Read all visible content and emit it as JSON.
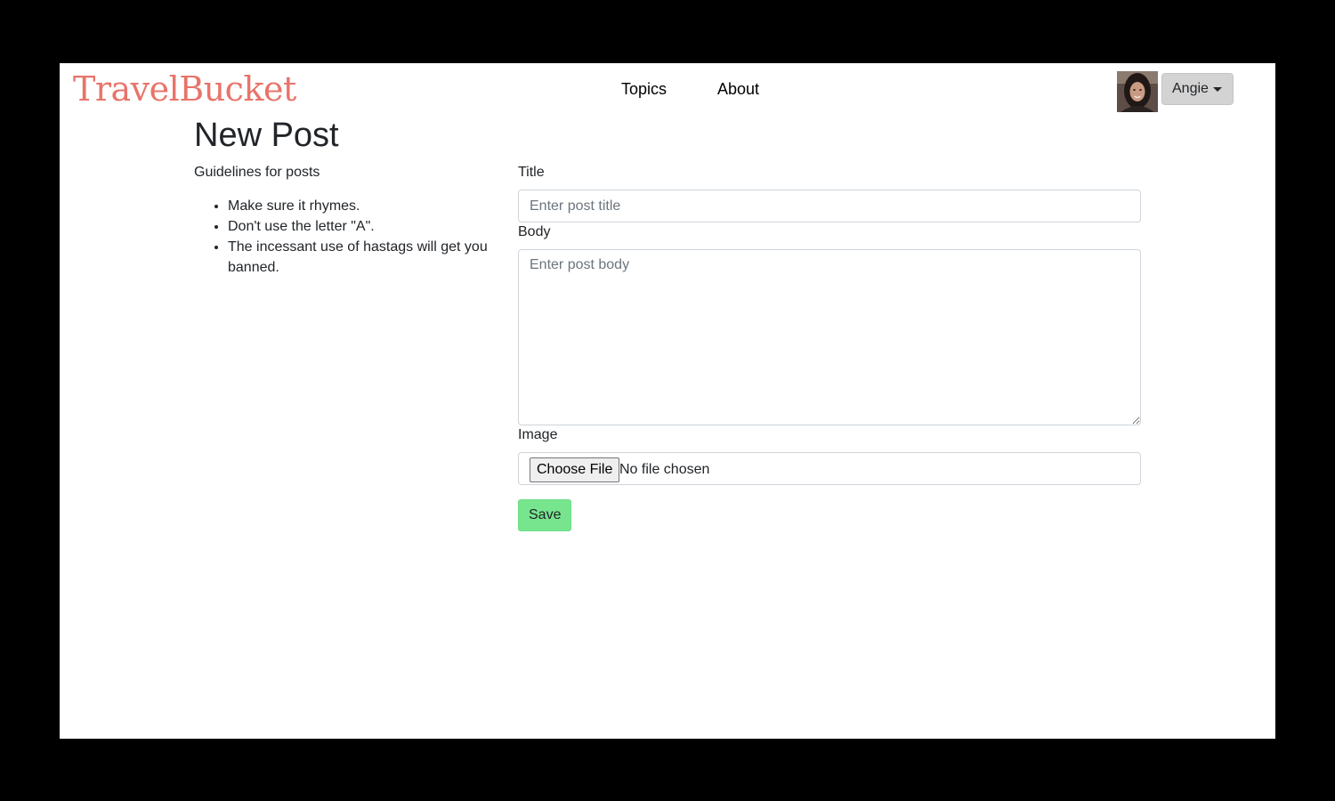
{
  "header": {
    "brand": "TravelBucket",
    "nav": [
      {
        "label": "Topics"
      },
      {
        "label": "About"
      }
    ],
    "user": {
      "name": "Angie",
      "avatar_icon": "user-avatar-photo"
    }
  },
  "main": {
    "title": "New Post",
    "guidelines": {
      "title": "Guidelines for posts",
      "items": [
        "Make sure it rhymes.",
        "Don't use the letter \"A\".",
        "The incessant use of hastags will get you banned."
      ]
    },
    "form": {
      "title_label": "Title",
      "title_placeholder": "Enter post title",
      "body_label": "Body",
      "body_placeholder": "Enter post body",
      "image_label": "Image",
      "file_button": "Choose File",
      "file_status": "No file chosen",
      "save_label": "Save"
    }
  },
  "colors": {
    "brand": "#e8746a",
    "save_button": "#77e58e",
    "user_button": "#d3d3d3"
  }
}
